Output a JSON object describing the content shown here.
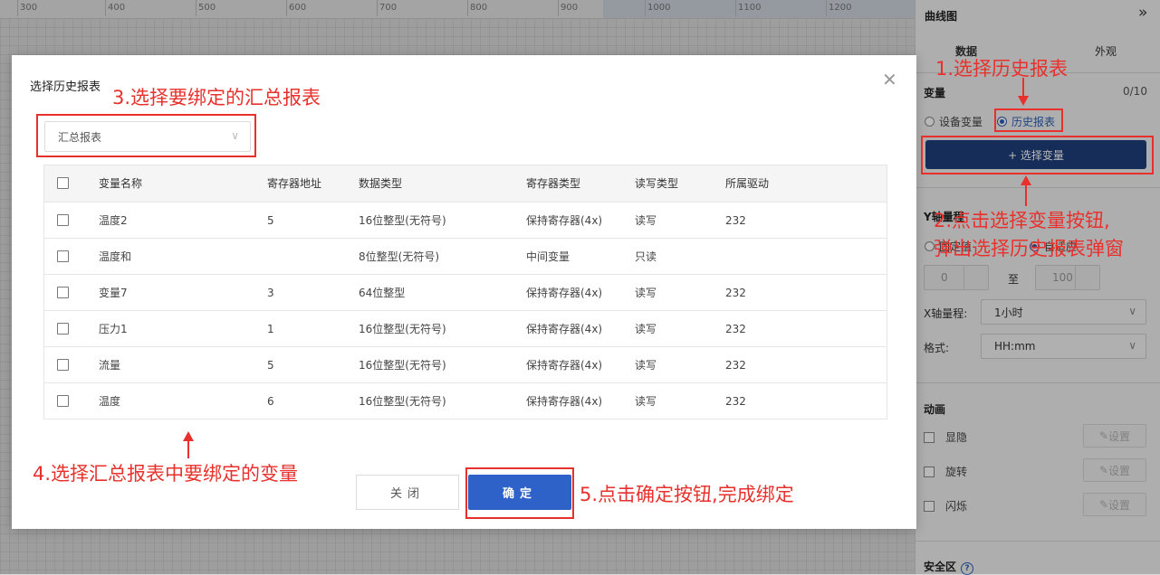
{
  "ruler": {
    "ticks": [
      "300",
      "400",
      "500",
      "600",
      "700",
      "800",
      "900",
      "1000",
      "1100",
      "1200"
    ]
  },
  "right_panel": {
    "title": "曲线图",
    "collapse_icon": "double-chevron-right-icon",
    "tabs": [
      "数据",
      "外观"
    ],
    "variable_label": "变量",
    "variable_count": "0/10",
    "radios": [
      {
        "label": "设备变量",
        "checked": false
      },
      {
        "label": "历史报表",
        "checked": true
      }
    ],
    "select_variable_button": "+ 选择变量",
    "y_range_label": "Y轴量程",
    "y_range_radios": [
      {
        "label": "固定值",
        "checked": false
      },
      {
        "label": "自适应",
        "checked": true
      }
    ],
    "y_min": "0",
    "to_label": "至",
    "y_max": "100",
    "x_range_label": "X轴量程:",
    "x_range_value": "1小时",
    "format_label": "格式:",
    "format_value": "HH:mm",
    "animation_label": "动画",
    "animations": [
      {
        "label": "显隐",
        "button": "设置"
      },
      {
        "label": "旋转",
        "button": "设置"
      },
      {
        "label": "闪烁",
        "button": "设置"
      }
    ],
    "safe_zone_label": "安全区"
  },
  "modal": {
    "title": "选择历史报表",
    "close_icon": "close-icon",
    "report_select_value": "汇总报表",
    "table": {
      "headers": [
        "变量名称",
        "寄存器地址",
        "数据类型",
        "寄存器类型",
        "读写类型",
        "所属驱动"
      ],
      "rows": [
        [
          "温度2",
          "5",
          "16位整型(无符号)",
          "保持寄存器(4x)",
          "读写",
          "232"
        ],
        [
          "温度和",
          "",
          "8位整型(无符号)",
          "中间变量",
          "只读",
          ""
        ],
        [
          "变量7",
          "3",
          "64位整型",
          "保持寄存器(4x)",
          "读写",
          "232"
        ],
        [
          "压力1",
          "1",
          "16位整型(无符号)",
          "保持寄存器(4x)",
          "读写",
          "232"
        ],
        [
          "流量",
          "5",
          "16位整型(无符号)",
          "保持寄存器(4x)",
          "读写",
          "232"
        ],
        [
          "温度",
          "6",
          "16位整型(无符号)",
          "保持寄存器(4x)",
          "读写",
          "232"
        ]
      ]
    },
    "close_button": "关闭",
    "confirm_button": "确定"
  },
  "annotations": {
    "step1": "1.选择历史报表",
    "step2_line1": "2.点击选择变量按钮,",
    "step2_line2": "弹出选择历史报表弹窗",
    "step3": "3.选择要绑定的汇总报表",
    "step4": "4.选择汇总报表中要绑定的变量",
    "step5": "5.点击确定按钮,完成绑定",
    "color": "#e8312d"
  }
}
